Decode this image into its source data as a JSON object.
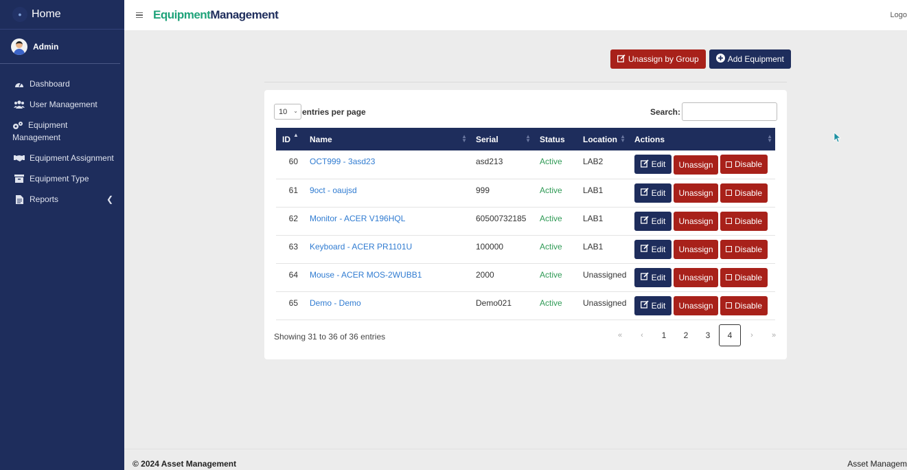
{
  "sidebar": {
    "brand": "Home",
    "user": "Admin",
    "items": [
      {
        "label": "Dashboard"
      },
      {
        "label": "User Management"
      },
      {
        "label": "Equipment",
        "label2": "Management"
      },
      {
        "label": "Equipment Assignment"
      },
      {
        "label": "Equipment Type"
      },
      {
        "label": "Reports"
      }
    ]
  },
  "header": {
    "title_part1": "Equipment",
    "title_part2": "Management",
    "logout": "Logo"
  },
  "toolbar": {
    "unassign_group": "Unassign by Group",
    "add_equipment": "Add Equipment"
  },
  "table_controls": {
    "entries_value": "10",
    "entries_label": "entries per page",
    "search_label": "Search:"
  },
  "table": {
    "headers": [
      "ID",
      "Name",
      "Serial",
      "Status",
      "Location",
      "Actions"
    ],
    "rows": [
      {
        "id": "60",
        "name": "OCT999 - 3asd23",
        "serial": "asd213",
        "status": "Active",
        "location": "LAB2"
      },
      {
        "id": "61",
        "name": "9oct - oaujsd",
        "serial": "999",
        "status": "Active",
        "location": "LAB1"
      },
      {
        "id": "62",
        "name": "Monitor - ACER V196HQL",
        "serial": "60500732185",
        "status": "Active",
        "location": "LAB1"
      },
      {
        "id": "63",
        "name": "Keyboard - ACER PR1101U",
        "serial": "100000",
        "status": "Active",
        "location": "LAB1"
      },
      {
        "id": "64",
        "name": "Mouse - ACER MOS-2WUBB1",
        "serial": "2000",
        "status": "Active",
        "location": "Unassigned"
      },
      {
        "id": "65",
        "name": "Demo - Demo",
        "serial": "Demo021",
        "status": "Active",
        "location": "Unassigned"
      }
    ],
    "actions": {
      "edit": "Edit",
      "unassign": "Unassign",
      "disable": "Disable"
    }
  },
  "pagination": {
    "info": "Showing 31 to 36 of 36 entries",
    "first": "«",
    "prev": "‹",
    "pages": [
      "1",
      "2",
      "3",
      "4"
    ],
    "current": "4",
    "next": "›",
    "last": "»"
  },
  "footer": {
    "copyright": "© 2024 Asset Management",
    "right": "Asset Managem"
  },
  "colors": {
    "sidebar": "#1e2d5c",
    "danger": "#a8211a",
    "accent_green": "#1fa37a",
    "link": "#2f7bd1"
  }
}
